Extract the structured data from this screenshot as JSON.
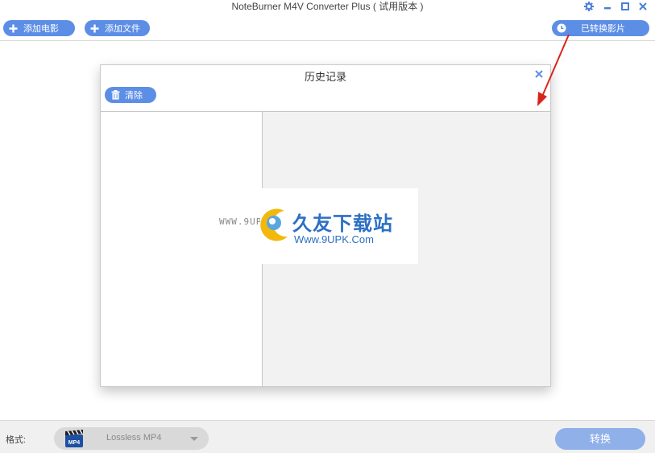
{
  "window": {
    "title": "NoteBurner M4V Converter Plus ( 试用版本 )"
  },
  "toolbar": {
    "add_movie_label": "添加电影",
    "add_file_label": "添加文件",
    "converted_label": "已转换影片"
  },
  "dialog": {
    "title": "历史记录",
    "clear_label": "清除"
  },
  "bottom": {
    "format_label": "格式:",
    "format_value": "Lossless MP4",
    "convert_label": "转换"
  },
  "watermark": {
    "small_text": "WWW.9UPK.COM",
    "big_text": "久友下载站",
    "url_text": "Www.9UPK.Com"
  },
  "colors": {
    "accent": "#5d8ee6",
    "convert_disabled": "#8fb0e8",
    "annotation": "#d9241c"
  }
}
